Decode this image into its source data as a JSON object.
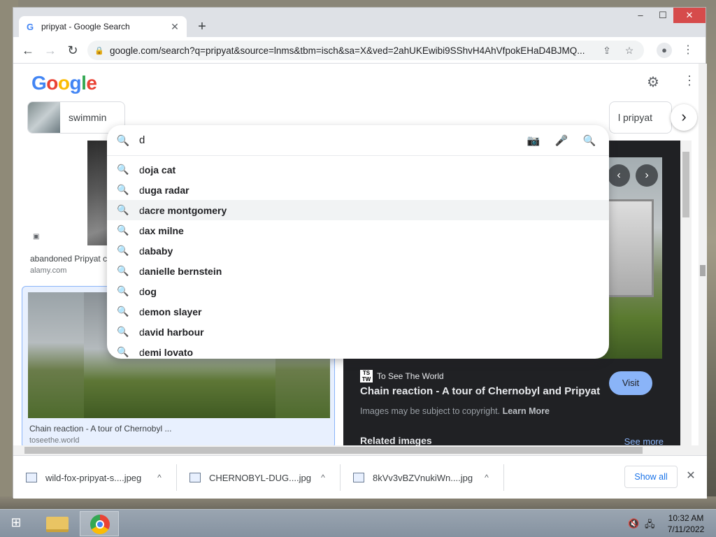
{
  "browser": {
    "tab_title": "pripyat - Google Search",
    "tab_favicon": "G",
    "new_tab": "+",
    "url": "google.com/search?q=pripyat&source=lnms&tbm=isch&sa=X&ved=2ahUKEwibi9SShvH4AhVfpokEHaD4BJMQ...",
    "controls": {
      "minimize": "–",
      "maximize": "☐",
      "close": "✕"
    }
  },
  "google": {
    "logo": "Google",
    "chips": [
      {
        "label": "swimmin"
      },
      {
        "label": "l pripyat"
      }
    ]
  },
  "search": {
    "value": "d",
    "suggestions": [
      {
        "prefix": "d",
        "rest": "oja cat"
      },
      {
        "prefix": "d",
        "rest": "uga radar"
      },
      {
        "prefix": "d",
        "rest": "acre montgomery"
      },
      {
        "prefix": "d",
        "rest": "ax milne"
      },
      {
        "prefix": "d",
        "rest": "ababy"
      },
      {
        "prefix": "d",
        "rest": "anielle bernstein"
      },
      {
        "prefix": "d",
        "rest": "og"
      },
      {
        "prefix": "d",
        "rest": "emon slayer"
      },
      {
        "prefix": "d",
        "rest": "avid harbour"
      },
      {
        "prefix": "d",
        "rest": "emi lovato"
      }
    ],
    "highlighted_index": 2
  },
  "results": [
    {
      "caption": "abandoned Pripyat c",
      "source": "alamy.com"
    },
    {
      "caption": "Chain reaction - A tour of Chernobyl ...",
      "source": "toseethe.world"
    }
  ],
  "preview": {
    "site_favicon": "TS TW",
    "site_name": "To See The World",
    "title": "Chain reaction - A tour of Chernobyl and Pripyat",
    "copyright_text": "Images may be subject to copyright.",
    "learn_more": "Learn More",
    "visit": "Visit",
    "related": "Related images",
    "see_more": "See more"
  },
  "downloads": {
    "items": [
      {
        "name": "wild-fox-pripyat-s....jpeg"
      },
      {
        "name": "CHERNOBYL-DUG....jpg"
      },
      {
        "name": "8kVv3vBZVnukiWn....jpg"
      }
    ],
    "show_all": "Show all"
  },
  "taskbar": {
    "time": "10:32 AM",
    "date": "7/11/2022"
  }
}
